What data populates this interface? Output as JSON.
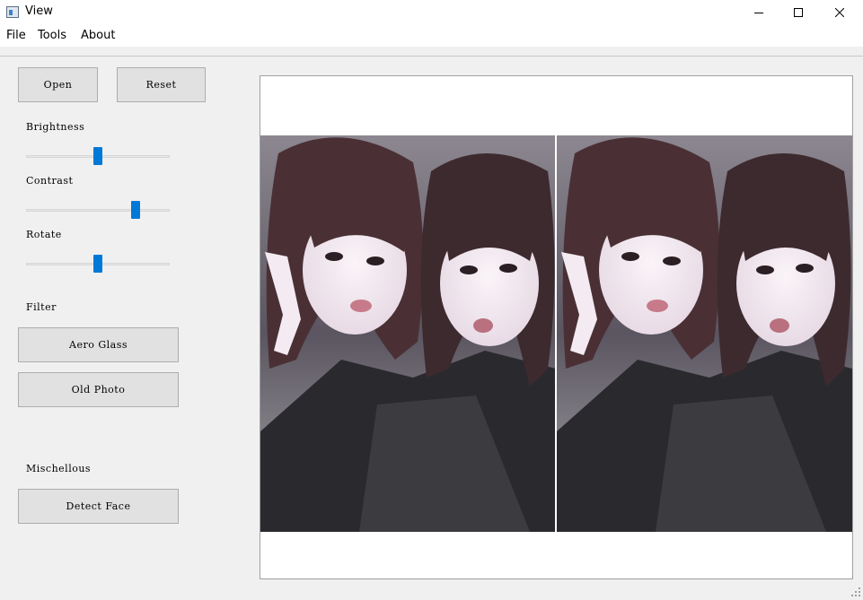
{
  "window": {
    "title": "View"
  },
  "menu": {
    "items": [
      "File",
      "Tools",
      "About"
    ]
  },
  "toolbar": {
    "open_label": "Open",
    "reset_label": "Reset"
  },
  "adjustments": {
    "brightness_label": "Brightness",
    "brightness_value": 0.5,
    "contrast_label": "Contrast",
    "contrast_value": 0.78,
    "rotate_label": "Rotate",
    "rotate_value": 0.5
  },
  "filter": {
    "section_label": "Filter",
    "aero_glass_label": "Aero Glass",
    "old_photo_label": "Old Photo"
  },
  "misc": {
    "section_label": "Mischellous",
    "detect_face_label": "Detect Face"
  },
  "canvas": {
    "image": "photo of two women shown side by side, mirrored"
  },
  "colors": {
    "accent": "#0078d7",
    "panel": "#f0f0f0",
    "button": "#e1e1e1"
  }
}
